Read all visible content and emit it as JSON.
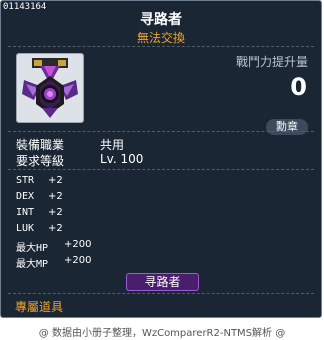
{
  "item_id": "01143164",
  "title": "寻路者",
  "trade_status": "無法交換",
  "icon": "purple-winged-medal-icon",
  "power": {
    "label": "戰鬥力提升量",
    "value": "0"
  },
  "category_badge": "勳章",
  "requirements": [
    {
      "label": "裝備職業",
      "value": "共用"
    },
    {
      "label": "要求等級",
      "value": "Lv. 100"
    }
  ],
  "stats": [
    {
      "name": "STR",
      "value": "+2"
    },
    {
      "name": "DEX",
      "value": "+2"
    },
    {
      "name": "INT",
      "value": "+2"
    },
    {
      "name": "LUK",
      "value": "+2"
    },
    {
      "name": "最大HP",
      "value": "+200"
    },
    {
      "name": "最大MP",
      "value": "+200"
    }
  ],
  "name_tag": "寻路者",
  "exclusive_label": "專屬道具",
  "footer": "@ 数据由小册子整理，WzComparerR2-NTMS解析 @",
  "colors": {
    "background": "#1b2634",
    "accent_orange": "#f0a22a",
    "tag_purple": "#4a1e6b"
  }
}
